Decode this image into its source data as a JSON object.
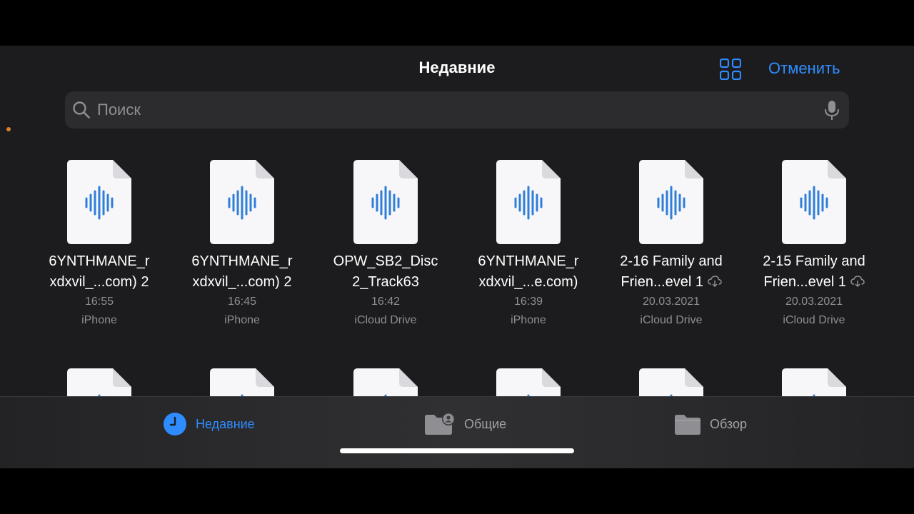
{
  "header": {
    "title": "Недавние",
    "cancel_label": "Отменить",
    "view_toggle_icon": "grid-view-icon",
    "accent": "#2f8cff"
  },
  "search": {
    "placeholder": "Поиск",
    "left_icon": "search-icon",
    "right_icon": "microphone-icon"
  },
  "files": [
    {
      "name_line1": "6YNTHMANE_r",
      "name_line2": "xdxvil_...com) 2",
      "time": "16:55",
      "location": "iPhone",
      "cloud": false
    },
    {
      "name_line1": "6YNTHMANE_r",
      "name_line2": "xdxvil_...com) 2",
      "time": "16:45",
      "location": "iPhone",
      "cloud": false
    },
    {
      "name_line1": "OPW_SB2_Disc",
      "name_line2": "2_Track63",
      "time": "16:42",
      "location": "iCloud Drive",
      "cloud": false
    },
    {
      "name_line1": "6YNTHMANE_r",
      "name_line2": "xdxvil_...e.com)",
      "time": "16:39",
      "location": "iPhone",
      "cloud": false
    },
    {
      "name_line1": "2-16 Family and",
      "name_line2": "Frien...evel 1",
      "time": "20.03.2021",
      "location": "iCloud Drive",
      "cloud": true
    },
    {
      "name_line1": "2-15 Family and",
      "name_line2": "Frien...evel 1",
      "time": "20.03.2021",
      "location": "iCloud Drive",
      "cloud": true
    }
  ],
  "tabbar": {
    "tabs": [
      {
        "label": "Недавние",
        "icon": "clock-icon",
        "active": true
      },
      {
        "label": "Общие",
        "icon": "shared-folder-icon",
        "active": false
      },
      {
        "label": "Обзор",
        "icon": "folder-icon",
        "active": false
      }
    ]
  }
}
